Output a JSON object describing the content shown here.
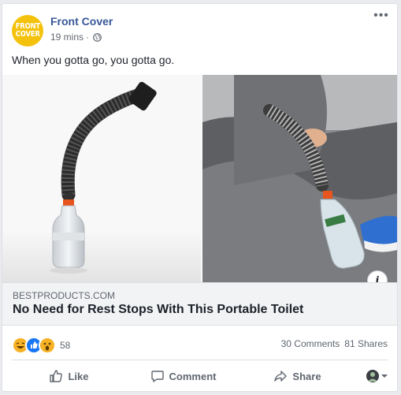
{
  "post": {
    "page_name": "Front Cover",
    "avatar_text_line1": "FRONT",
    "avatar_text_line2": "COVER",
    "timestamp": "19 mins",
    "separator": "·",
    "privacy_icon": "globe-icon",
    "text": "When you gotta go, you gotta go."
  },
  "link": {
    "domain": "BESTPRODUCTS.COM",
    "title": "No Need for Rest Stops With This Portable Toilet",
    "info_icon": "i"
  },
  "stats": {
    "reactions": [
      "haha",
      "like",
      "wow"
    ],
    "reaction_count": "58",
    "comments": "30 Comments",
    "shares": "81 Shares"
  },
  "actions": {
    "like": "Like",
    "comment": "Comment",
    "share": "Share"
  },
  "colors": {
    "brand_link": "#385898",
    "like_blue": "#1877f2",
    "reaction_yellow": "#f7b125",
    "avatar_yellow": "#f4c20d"
  }
}
